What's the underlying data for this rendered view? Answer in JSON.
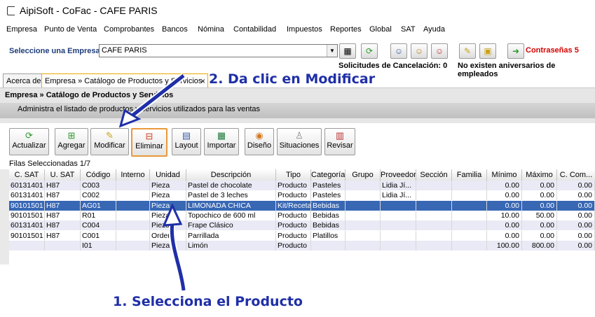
{
  "window": {
    "title": "AipiSoft - CoFac - CAFE PARIS"
  },
  "menu": [
    "Empresa",
    "Punto de Venta",
    "Comprobantes",
    "Bancos",
    "Nómina",
    "Contabilidad",
    "Impuestos",
    "Reportes",
    "Global",
    "SAT",
    "Ayuda"
  ],
  "company": {
    "label": "Seleccione una Empresa",
    "value": "CAFE PARIS"
  },
  "contrasenas": "Contraseñas 5",
  "status": {
    "cancel": "Solicitudes de Cancelación: 0",
    "aniv": "No existen aniversarios de empleados"
  },
  "tabs": [
    "Acerca de",
    "Empresa » Catálogo de Productos y Servicios"
  ],
  "panel": {
    "title": "Empresa » Catálogo de Productos y Servicios",
    "subtitle": "Administra el listado de productos y servicios utilizados para las ventas"
  },
  "toolbar": [
    "Actualizar",
    "Agregar",
    "Modificar",
    "Eliminar",
    "Layout",
    "Importar",
    "Diseño",
    "Situaciones",
    "Revisar"
  ],
  "grid": {
    "filas": "Filas Seleccionadas  1/7",
    "headers": [
      "C. SAT",
      "U. SAT",
      "Código",
      "Interno",
      "Unidad",
      "Descripción",
      "Tipo",
      "Categoría",
      "Grupo",
      "Proveedor",
      "Sección",
      "Familia",
      "Mínimo",
      "Máximo",
      "C. Com..."
    ],
    "rows": [
      [
        "60131401",
        "H87",
        "C003",
        "",
        "Pieza",
        "Pastel de chocolate",
        "Producto",
        "Pasteles",
        "",
        "Lidia Jí...",
        "",
        "",
        "0.00",
        "0.00",
        "0.00"
      ],
      [
        "60131401",
        "H87",
        "C002",
        "",
        "Pieza",
        "Pastel de 3 leches",
        "Producto",
        "Pasteles",
        "",
        "Lidia Jí...",
        "",
        "",
        "0.00",
        "0.00",
        "0.00"
      ],
      [
        "90101501",
        "H87",
        "AG01",
        "",
        "Pieza",
        "LIMONADA CHICA",
        "Kit/Receta",
        "Bebidas",
        "",
        "",
        "",
        "",
        "0.00",
        "0.00",
        "0.00"
      ],
      [
        "90101501",
        "H87",
        "R01",
        "",
        "Pieza",
        "Topochico de 600 ml",
        "Producto",
        "Bebidas",
        "",
        "",
        "",
        "",
        "10.00",
        "50.00",
        "0.00"
      ],
      [
        "60131401",
        "H87",
        "C004",
        "",
        "Pieza",
        "Frape Clásico",
        "Producto",
        "Bebidas",
        "",
        "",
        "",
        "",
        "0.00",
        "0.00",
        "0.00"
      ],
      [
        "90101501",
        "H87",
        "C001",
        "",
        "Orden",
        "Parrillada",
        "Producto",
        "Platillos",
        "",
        "",
        "",
        "",
        "0.00",
        "0.00",
        "0.00"
      ],
      [
        "",
        "",
        "I01",
        "",
        "Pieza",
        "Limón",
        "Producto",
        "",
        "",
        "",
        "",
        "",
        "100.00",
        "800.00",
        "0.00"
      ]
    ]
  },
  "annotations": {
    "step1": "1. Selecciona el Producto",
    "step2": "2. Da clic en Modificar"
  },
  "colors": {
    "selected": "#3867b4",
    "annotation": "#1f2fa8",
    "highlight": "#e89a3a",
    "alert": "#d40000"
  }
}
